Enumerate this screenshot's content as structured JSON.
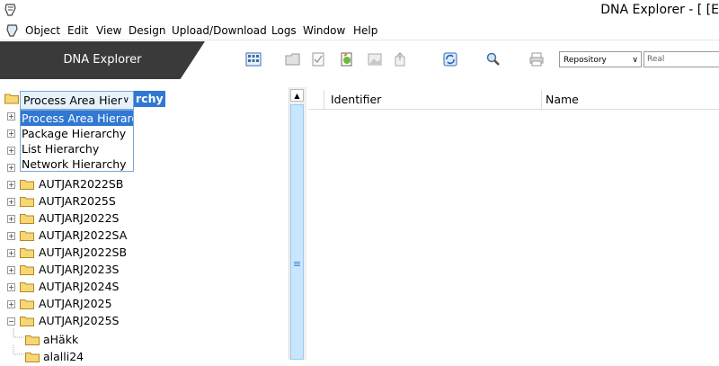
{
  "window": {
    "title": "DNA Explorer - [ [E"
  },
  "menu": {
    "items": [
      "Object",
      "Edit",
      "View",
      "Design",
      "Upload/Download",
      "Logs",
      "Window",
      "Help"
    ]
  },
  "toolbar": {
    "brand": "DNA Explorer",
    "icons": [
      "grid-view-icon",
      "open-folder-icon",
      "checklist-icon",
      "refresh-document-icon",
      "image-icon",
      "export-icon",
      "sync-icon",
      "search-icon",
      "print-icon"
    ],
    "repository_select": "Repository",
    "search_value": "Real"
  },
  "tree": {
    "combo_value": "Process Area Hier",
    "combo_overflow_text": "rchy",
    "dropdown_options": [
      "Process Area Hierarc",
      "Package Hierarchy",
      "List Hierarchy",
      "Network Hierarchy"
    ],
    "nodes": [
      {
        "label": "AUTJAR2022SB",
        "expander": "+"
      },
      {
        "label": "AUTJAR2025S",
        "expander": "+"
      },
      {
        "label": "AUTJARJ2022S",
        "expander": "+"
      },
      {
        "label": "AUTJARJ2022SA",
        "expander": "+"
      },
      {
        "label": "AUTJARJ2022SB",
        "expander": "+"
      },
      {
        "label": "AUTJARJ2023S",
        "expander": "+"
      },
      {
        "label": "AUTJARJ2024S",
        "expander": "+"
      },
      {
        "label": "AUTJARJ2025",
        "expander": "+"
      },
      {
        "label": "AUTJARJ2025S",
        "expander": "−"
      }
    ],
    "children": [
      "aHäkk",
      "alalli24"
    ]
  },
  "grid": {
    "columns": [
      "Identifier",
      "Name"
    ]
  },
  "colors": {
    "brand_bg": "#3a3a3a",
    "selection": "#3078d4",
    "scroll_thumb": "#c9e6ff"
  }
}
